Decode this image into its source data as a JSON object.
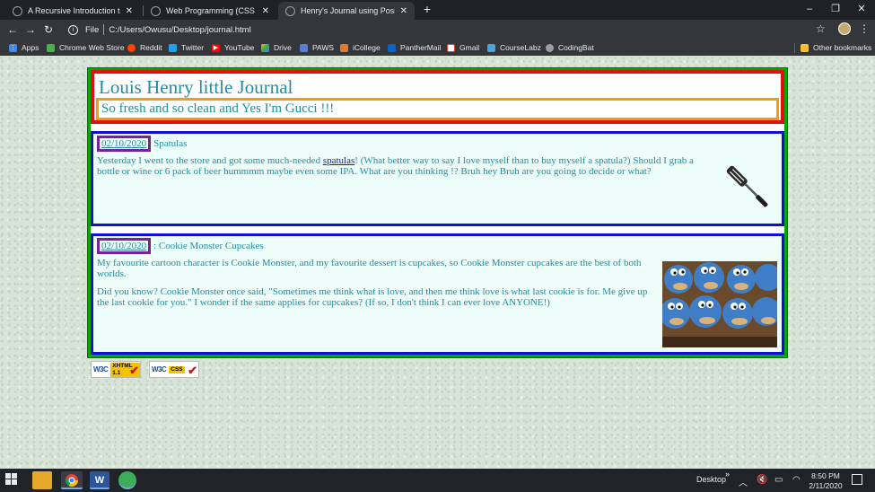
{
  "browser": {
    "tabs": [
      {
        "title": "A Recursive Introduction to the T",
        "active": false
      },
      {
        "title": "Web Programming (CSS Design :",
        "active": false
      },
      {
        "title": "Henry's Journal using Positioning",
        "active": true
      }
    ],
    "address": {
      "scheme": "File",
      "path": "C:/Users/Owusu/Desktop/journal.html"
    },
    "bookmarks": [
      {
        "label": "Apps",
        "icon": "apps-grid-icon",
        "color": "#e8eaed"
      },
      {
        "label": "Chrome Web Store",
        "icon": "web-store-icon",
        "color": "#4caf50"
      },
      {
        "label": "Reddit",
        "icon": "reddit-icon",
        "color": "#ff4500"
      },
      {
        "label": "Twitter",
        "icon": "twitter-icon",
        "color": "#1da1f2"
      },
      {
        "label": "YouTube",
        "icon": "youtube-icon",
        "color": "#ff0000"
      },
      {
        "label": "Drive",
        "icon": "drive-icon",
        "color": "#fbbc04"
      },
      {
        "label": "PAWS",
        "icon": "paws-icon",
        "color": "#5b7bd5"
      },
      {
        "label": "iCollege",
        "icon": "icollege-icon",
        "color": "#e07a2f"
      },
      {
        "label": "PantherMail",
        "icon": "panthermail-icon",
        "color": "#0a66c2"
      },
      {
        "label": "Gmail",
        "icon": "gmail-icon",
        "color": "#ea4335"
      },
      {
        "label": "CourseLabz",
        "icon": "courselabz-icon",
        "color": "#4aa3df"
      },
      {
        "label": "CodingBat",
        "icon": "codingbat-icon",
        "color": "#9e9e9e"
      }
    ],
    "other_bookmarks": "Other bookmarks"
  },
  "journal": {
    "title": "Louis Henry little Journal",
    "tagline": "So fresh and so clean and Yes I'm Gucci !!!",
    "entries": [
      {
        "date": "02/10/2020",
        "title": "Spatulas",
        "body_before_link": "Yesterday I went to the store and got some much-needed ",
        "link": "spatulas",
        "body_after_link": "! (What better way to say I love myself than to buy myself a spatula?) Should I grab a bottle or wine or 6 pack of beer hummmm maybe even some IPA. What are you thinking !? Bruh hey Bruh are you going to decide or what?",
        "image": "spatula-image"
      },
      {
        "date": "02/10/2020",
        "title": ": Cookie Monster Cupcakes",
        "paragraph1": "My favourite cartoon character is Cookie Monster, and my favourite dessert is cupcakes, so Cookie Monster cupcakes are the best of both worlds.",
        "paragraph2": "Did you know? Cookie Monster once said, \"Sometimes me think what is love, and then me think love is what last cookie is for. Me give up the last cookie for you.\" I wonder if the same applies for cupcakes? (If so, I don't think I can ever love ANYONE!)",
        "image": "cookie-monster-cupcakes-image"
      }
    ],
    "badges": [
      {
        "w3c": "W3C",
        "spec": "XHTML 1.1"
      },
      {
        "w3c": "W3C",
        "spec": "CSS"
      }
    ]
  },
  "taskbar": {
    "desktop_label": "Desktop",
    "time": "8:50 PM",
    "date": "2/11/2020"
  }
}
